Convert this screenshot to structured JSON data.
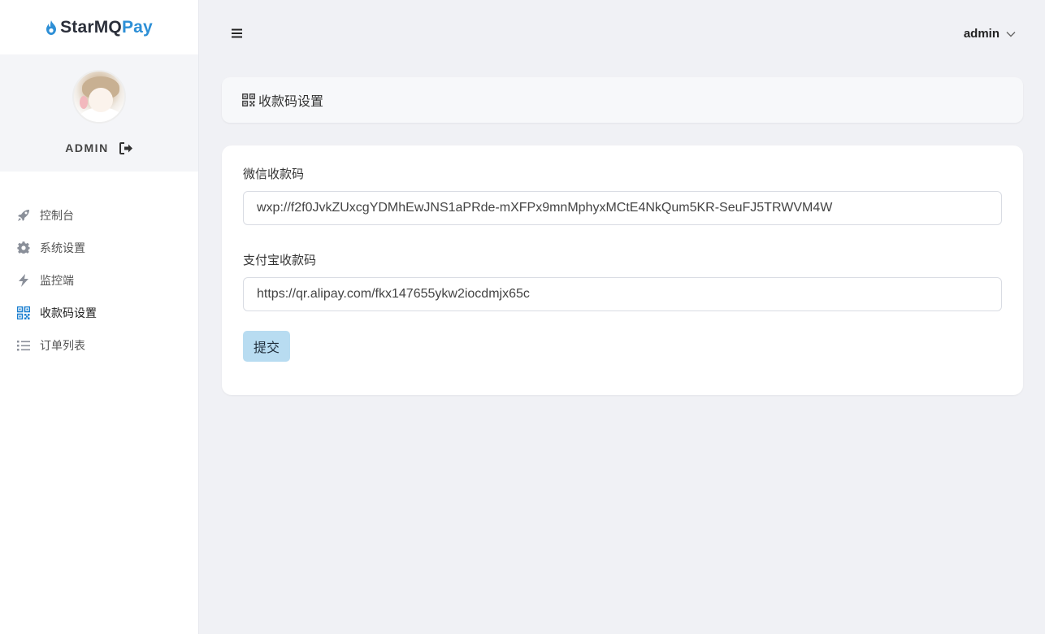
{
  "brand": {
    "name_main": "StarMQ",
    "name_accent": "Pay"
  },
  "user": {
    "name": "ADMIN"
  },
  "sidebar": {
    "items": [
      {
        "label": "控制台",
        "icon": "rocket-icon"
      },
      {
        "label": "系统设置",
        "icon": "gear-icon"
      },
      {
        "label": "监控端",
        "icon": "lightning-icon"
      },
      {
        "label": "收款码设置",
        "icon": "qrcode-icon",
        "active": true
      },
      {
        "label": "订单列表",
        "icon": "list-icon"
      }
    ]
  },
  "header": {
    "user_menu_label": "admin"
  },
  "page": {
    "title": "收款码设置"
  },
  "form": {
    "wechat": {
      "label": "微信收款码",
      "value": "wxp://f2f0JvkZUxcgYDMhEwJNS1aPRde-mXFPx9mnMphyxMCtE4NkQum5KR-SeuFJ5TRWVM4W"
    },
    "alipay": {
      "label": "支付宝收款码",
      "value": "https://qr.alipay.com/fkx147655ykw2iocdmjx65c"
    },
    "submit_label": "提交"
  },
  "colors": {
    "accent": "#2d8fd6",
    "active_icon": "#1a7fd0",
    "submit_bg": "#b8dcf1",
    "page_bg": "#f0f1f5"
  }
}
